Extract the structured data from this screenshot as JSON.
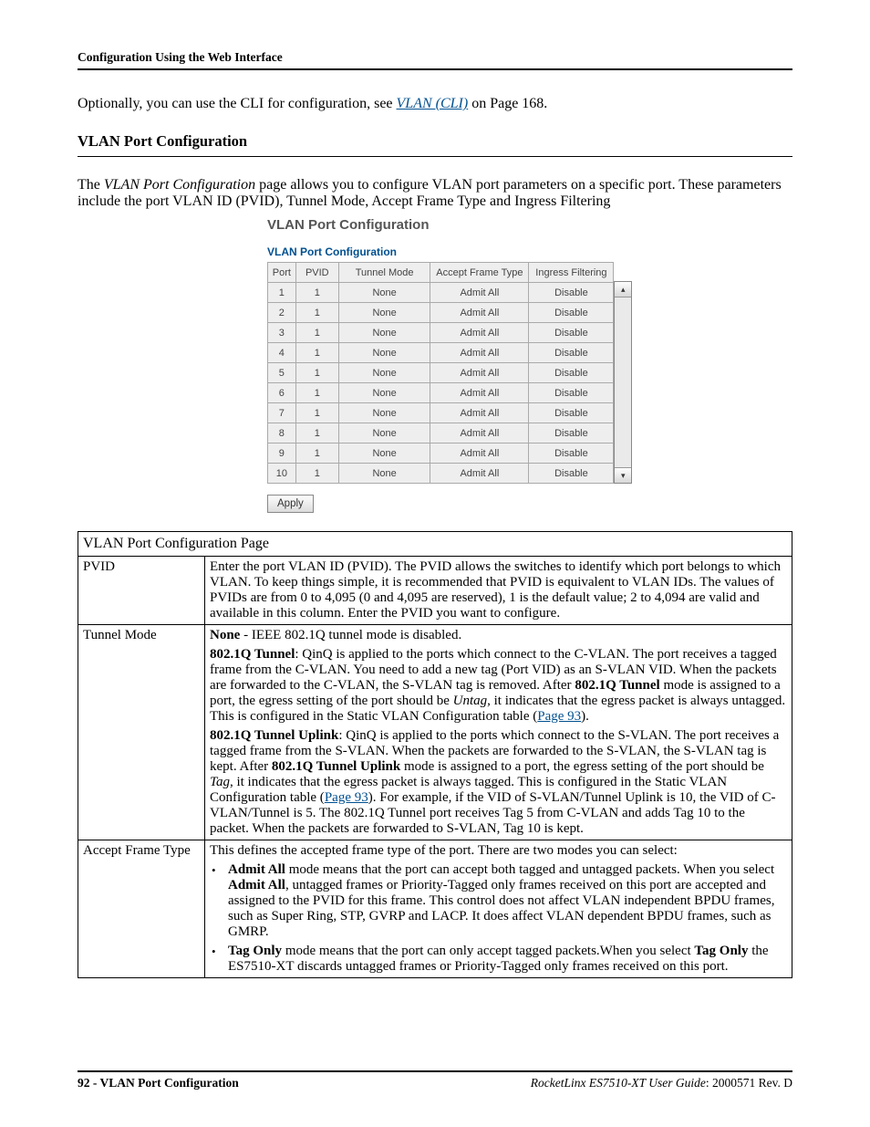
{
  "header": {
    "running": "Configuration Using the Web Interface"
  },
  "intro": {
    "prefix": "Optionally, you can use the CLI for configuration, see ",
    "link": "VLAN (CLI)",
    "suffix": " on Page 168."
  },
  "section": {
    "title": "VLAN Port Configuration",
    "para_prefix": "The ",
    "para_italic": "VLAN Port Configuration ",
    "para_rest": "page allows you to configure VLAN port parameters on a specific port. These parameters include the port VLAN ID (PVID), Tunnel Mode, Accept Frame Type and Ingress Filtering"
  },
  "ss": {
    "title": "VLAN Port Configuration",
    "subtitle": "VLAN Port Configuration",
    "headers": [
      "Port",
      "PVID",
      "Tunnel Mode",
      "Accept Frame Type",
      "Ingress Filtering"
    ],
    "rows": [
      {
        "port": "1",
        "pvid": "1",
        "tm": "None",
        "aft": "Admit All",
        "if": "Disable"
      },
      {
        "port": "2",
        "pvid": "1",
        "tm": "None",
        "aft": "Admit All",
        "if": "Disable"
      },
      {
        "port": "3",
        "pvid": "1",
        "tm": "None",
        "aft": "Admit All",
        "if": "Disable"
      },
      {
        "port": "4",
        "pvid": "1",
        "tm": "None",
        "aft": "Admit All",
        "if": "Disable"
      },
      {
        "port": "5",
        "pvid": "1",
        "tm": "None",
        "aft": "Admit All",
        "if": "Disable"
      },
      {
        "port": "6",
        "pvid": "1",
        "tm": "None",
        "aft": "Admit All",
        "if": "Disable"
      },
      {
        "port": "7",
        "pvid": "1",
        "tm": "None",
        "aft": "Admit All",
        "if": "Disable"
      },
      {
        "port": "8",
        "pvid": "1",
        "tm": "None",
        "aft": "Admit All",
        "if": "Disable"
      },
      {
        "port": "9",
        "pvid": "1",
        "tm": "None",
        "aft": "Admit All",
        "if": "Disable"
      },
      {
        "port": "10",
        "pvid": "1",
        "tm": "None",
        "aft": "Admit All",
        "if": "Disable"
      }
    ],
    "apply": "Apply"
  },
  "gloss": {
    "caption": "VLAN Port Configuration Page",
    "pvid": {
      "label": "PVID",
      "text": "Enter the port VLAN ID (PVID). The PVID allows the switches to identify which port belongs to which VLAN. To keep things simple, it is recommended that PVID is equivalent to VLAN IDs. The values of PVIDs are from 0 to 4,095 (0 and 4,095 are reserved), 1 is the default value; 2 to 4,094 are valid and available in this column. Enter the PVID you want to configure."
    },
    "tunnel": {
      "label": "Tunnel Mode",
      "none_bold": "None",
      "none_rest": " - IEEE 802.1Q tunnel mode is disabled.",
      "b1_lead": "802.1Q Tunnel",
      "b1_text_a": ": QinQ is applied to the ports which connect to the C-VLAN. The port receives a tagged frame from the C-VLAN. You need to add a new tag (Port VID) as an S-VLAN VID. When the packets are forwarded to the C-VLAN, the S-VLAN tag is removed. After ",
      "b1_text_b_bold": "802.1Q Tunnel",
      "b1_text_c": " mode is assigned to a port, the egress setting of the port should be ",
      "b1_text_c_italic": "Untag",
      "b1_text_d": ", it indicates that the egress packet is always untagged. This is configured in the Static VLAN Configuration table (",
      "b1_link": "Page 93",
      "b1_text_e": ").",
      "b2_lead": "802.1Q Tunnel Uplink",
      "b2_text_a": ": QinQ is applied to the ports which connect to the S-VLAN. The port receives a tagged frame from the S-VLAN. When the packets are forwarded to the S-VLAN, the S-VLAN tag is kept. After ",
      "b2_text_b_bold": "802.1Q Tunnel Uplink",
      "b2_text_c": " mode is assigned to a port, the egress setting of the port should be ",
      "b2_text_c_italic": "Tag",
      "b2_text_d": ", it indicates that the egress packet is always tagged. This is configured in the Static VLAN Configuration table (",
      "b2_link": "Page 93",
      "b2_text_e": "). For example, if the VID of S-VLAN/Tunnel Uplink is 10, the VID of C-VLAN/Tunnel is 5. The 802.1Q Tunnel port receives Tag 5 from C-VLAN and adds Tag 10 to the packet. When the packets are forwarded to S-VLAN, Tag 10 is kept."
    },
    "accept": {
      "label": "Accept Frame Type",
      "intro": "This defines the accepted frame type of the port. There are two modes you can select:",
      "bul1_lead": "Admit All",
      "bul1_mid": " mode means that the port can accept both tagged and untagged packets. When you select ",
      "bul1_bold2": "Admit All",
      "bul1_rest": ", untagged frames or Priority-Tagged only frames received on this port are accepted and assigned to the PVID for this frame. This control does not affect VLAN independent BPDU frames, such as Super Ring, STP, GVRP and LACP. It does affect VLAN dependent BPDU frames, such as GMRP.",
      "bul2_lead": "Tag Only",
      "bul2_mid": " mode means that the port can only accept tagged packets.When you select ",
      "bul2_bold2": "Tag Only",
      "bul2_rest": " the ES7510-XT discards untagged frames or Priority-Tagged only frames received on this port."
    }
  },
  "footer": {
    "left_page": "92 - ",
    "left_topic": "VLAN Port Configuration",
    "right_prefix_italic": "RocketLinx ES7510-XT  User Guide",
    "right_suffix": ": 2000571 Rev. D"
  }
}
